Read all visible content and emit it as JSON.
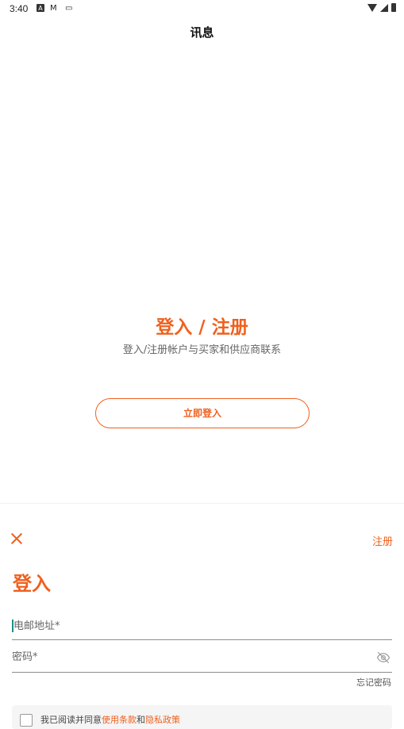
{
  "status_bar": {
    "time": "3:40"
  },
  "header": {
    "title": "讯息"
  },
  "hero": {
    "title": "登入 / 注册",
    "subtitle": "登入/注册帐户与买家和供应商联系",
    "login_now_label": "立即登入"
  },
  "sheet": {
    "register_label": "注册",
    "title": "登入",
    "email_placeholder": "电邮地址*",
    "password_placeholder": "密码*",
    "forgot_password": "忘记密码",
    "terms_prefix": "我已阅读并同意",
    "terms_link": "使用条款",
    "terms_and": "和",
    "privacy_link": "隐私政策"
  },
  "colors": {
    "accent": "#f0601e",
    "cursor": "#1c8f8a"
  }
}
